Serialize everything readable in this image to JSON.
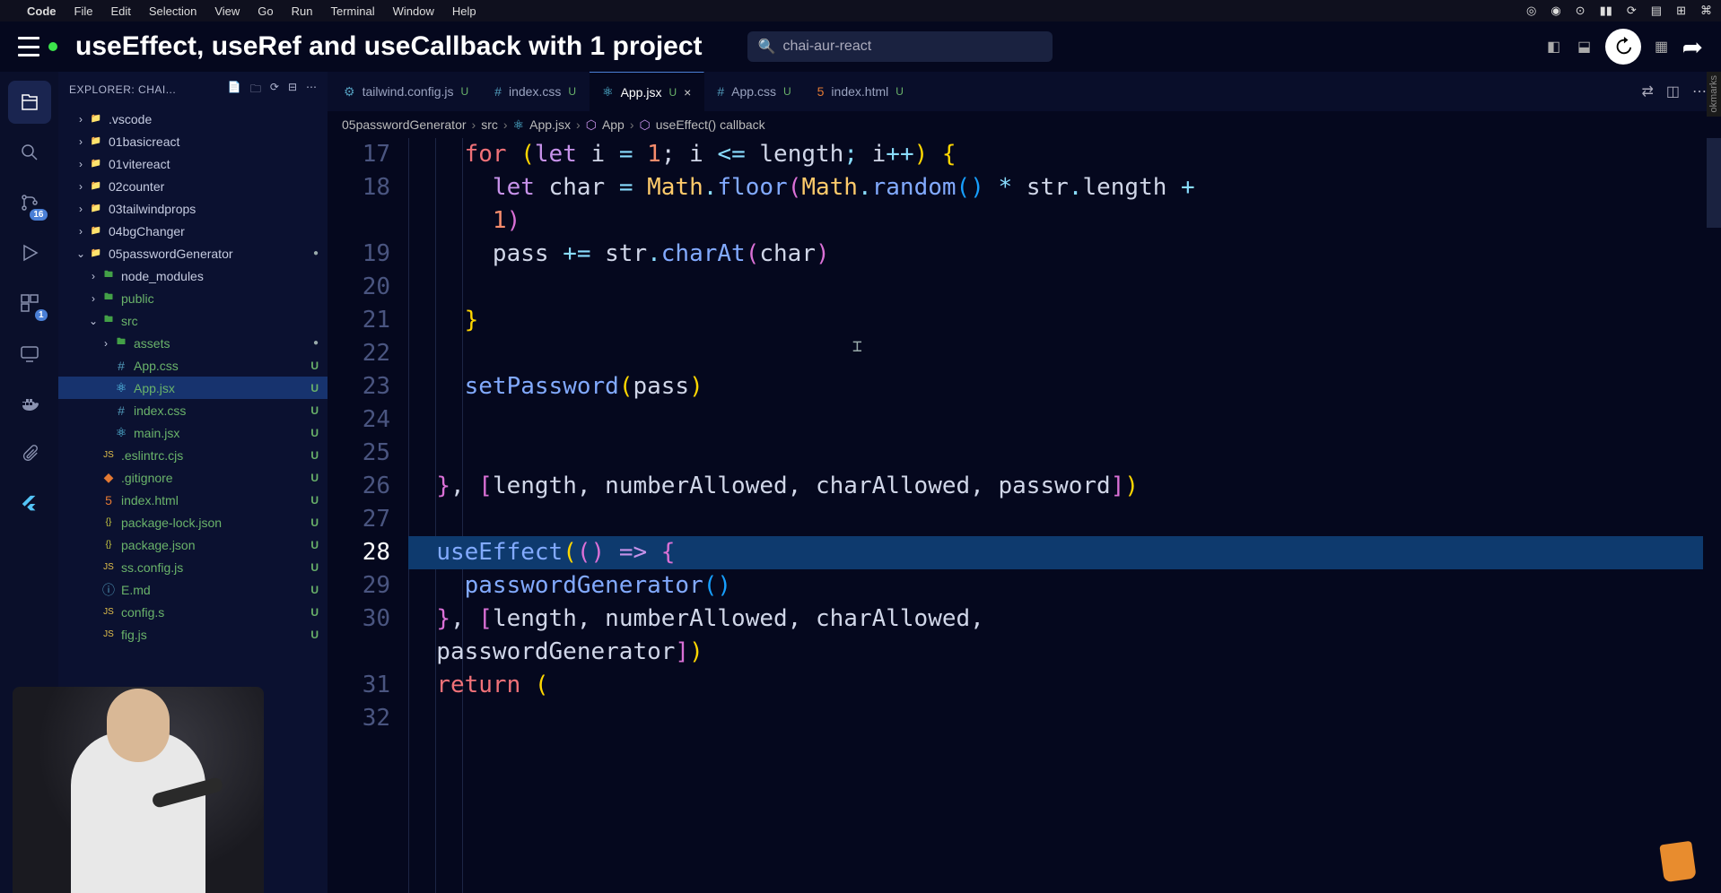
{
  "mac_menu": {
    "apple": "",
    "app": "Code",
    "items": [
      "File",
      "Edit",
      "Selection",
      "View",
      "Go",
      "Run",
      "Terminal",
      "Window",
      "Help"
    ]
  },
  "video": {
    "title": "useEffect, useRef and useCallback with 1 project",
    "search_value": "chai-aur-react"
  },
  "activity": {
    "scm_badge": "16",
    "ext_badge": "1"
  },
  "sidebar": {
    "explorer_label": "EXPLORER: CHAI..."
  },
  "tree": [
    {
      "depth": 1,
      "chev": "›",
      "icon": "📁",
      "cls": "folder-icon",
      "name": ".vscode",
      "status": "",
      "active": false,
      "untracked": false,
      "dot": false
    },
    {
      "depth": 1,
      "chev": "›",
      "icon": "📁",
      "cls": "folder-icon",
      "name": "01basicreact",
      "status": "",
      "active": false,
      "untracked": false,
      "dot": false
    },
    {
      "depth": 1,
      "chev": "›",
      "icon": "📁",
      "cls": "folder-icon",
      "name": "01vitereact",
      "status": "",
      "active": false,
      "untracked": false,
      "dot": false
    },
    {
      "depth": 1,
      "chev": "›",
      "icon": "📁",
      "cls": "folder-icon",
      "name": "02counter",
      "status": "",
      "active": false,
      "untracked": false,
      "dot": false
    },
    {
      "depth": 1,
      "chev": "›",
      "icon": "📁",
      "cls": "folder-icon",
      "name": "03tailwindprops",
      "status": "",
      "active": false,
      "untracked": false,
      "dot": false
    },
    {
      "depth": 1,
      "chev": "›",
      "icon": "📁",
      "cls": "folder-icon",
      "name": "04bgChanger",
      "status": "",
      "active": false,
      "untracked": false,
      "dot": false
    },
    {
      "depth": 1,
      "chev": "⌄",
      "icon": "📁",
      "cls": "folder-icon",
      "name": "05passwordGenerator",
      "status": "",
      "active": false,
      "untracked": false,
      "dot": true
    },
    {
      "depth": 2,
      "chev": "›",
      "icon": "🖿",
      "cls": "folder-green",
      "name": "node_modules",
      "status": "",
      "active": false,
      "untracked": false,
      "dot": false
    },
    {
      "depth": 2,
      "chev": "›",
      "icon": "🖿",
      "cls": "folder-green",
      "name": "public",
      "status": "",
      "active": false,
      "untracked": true,
      "dot": false
    },
    {
      "depth": 2,
      "chev": "⌄",
      "icon": "🖿",
      "cls": "folder-green",
      "name": "src",
      "status": "",
      "active": false,
      "untracked": true,
      "dot": false
    },
    {
      "depth": 3,
      "chev": "›",
      "icon": "🖿",
      "cls": "folder-green",
      "name": "assets",
      "status": "",
      "active": false,
      "untracked": true,
      "dot": true
    },
    {
      "depth": 3,
      "chev": "",
      "icon": "#",
      "cls": "file-blue",
      "name": "App.css",
      "status": "U",
      "active": false,
      "untracked": true,
      "dot": false
    },
    {
      "depth": 3,
      "chev": "",
      "icon": "⚛",
      "cls": "file-react",
      "name": "App.jsx",
      "status": "U",
      "active": true,
      "untracked": true,
      "dot": false
    },
    {
      "depth": 3,
      "chev": "",
      "icon": "#",
      "cls": "file-blue",
      "name": "index.css",
      "status": "U",
      "active": false,
      "untracked": true,
      "dot": false
    },
    {
      "depth": 3,
      "chev": "",
      "icon": "⚛",
      "cls": "file-react",
      "name": "main.jsx",
      "status": "U",
      "active": false,
      "untracked": true,
      "dot": false
    },
    {
      "depth": 2,
      "chev": "",
      "icon": "JS",
      "cls": "file-yellow",
      "name": ".eslintrc.cjs",
      "status": "U",
      "active": false,
      "untracked": true,
      "dot": false
    },
    {
      "depth": 2,
      "chev": "",
      "icon": "◆",
      "cls": "file-orange",
      "name": ".gitignore",
      "status": "U",
      "active": false,
      "untracked": true,
      "dot": false
    },
    {
      "depth": 2,
      "chev": "",
      "icon": "5",
      "cls": "file-orange",
      "name": "index.html",
      "status": "U",
      "active": false,
      "untracked": true,
      "dot": false
    },
    {
      "depth": 2,
      "chev": "",
      "icon": "{}",
      "cls": "file-json",
      "name": "package-lock.json",
      "status": "U",
      "active": false,
      "untracked": true,
      "dot": false
    },
    {
      "depth": 2,
      "chev": "",
      "icon": "{}",
      "cls": "file-json",
      "name": "package.json",
      "status": "U",
      "active": false,
      "untracked": true,
      "dot": false
    },
    {
      "depth": 2,
      "chev": "",
      "icon": "JS",
      "cls": "file-yellow",
      "name": "ss.config.js",
      "status": "U",
      "active": false,
      "untracked": true,
      "dot": false
    },
    {
      "depth": 2,
      "chev": "",
      "icon": "ⓘ",
      "cls": "file-blue",
      "name": "E.md",
      "status": "U",
      "active": false,
      "untracked": true,
      "dot": false
    },
    {
      "depth": 2,
      "chev": "",
      "icon": "JS",
      "cls": "file-yellow",
      "name": "config.s",
      "status": "U",
      "active": false,
      "untracked": true,
      "dot": false
    },
    {
      "depth": 2,
      "chev": "",
      "icon": "JS",
      "cls": "file-yellow",
      "name": "fig.js",
      "status": "U",
      "active": false,
      "untracked": true,
      "dot": false
    }
  ],
  "tabs": [
    {
      "icon": "⚙",
      "cls": "file-blue",
      "label": "tailwind.config.js",
      "status": "U",
      "active": false,
      "close": false
    },
    {
      "icon": "#",
      "cls": "file-blue",
      "label": "index.css",
      "status": "U",
      "active": false,
      "close": false
    },
    {
      "icon": "⚛",
      "cls": "file-react",
      "label": "App.jsx",
      "status": "U",
      "active": true,
      "close": true
    },
    {
      "icon": "#",
      "cls": "file-blue",
      "label": "App.css",
      "status": "U",
      "active": false,
      "close": false
    },
    {
      "icon": "5",
      "cls": "file-orange",
      "label": "index.html",
      "status": "U",
      "active": false,
      "close": false
    }
  ],
  "breadcrumb": {
    "parts": [
      "05passwordGenerator",
      "src",
      "App.jsx",
      "App",
      "useEffect() callback"
    ]
  },
  "code": {
    "lines": [
      {
        "num": "17",
        "active": false,
        "tokens": [
          {
            "t": "    ",
            "c": ""
          },
          {
            "t": "for",
            "c": "tk-kw"
          },
          {
            "t": " ",
            "c": ""
          },
          {
            "t": "(",
            "c": "tk-paren"
          },
          {
            "t": "let",
            "c": "tk-kw2"
          },
          {
            "t": " i ",
            "c": "tk-id"
          },
          {
            "t": "=",
            "c": "tk-op"
          },
          {
            "t": " ",
            "c": ""
          },
          {
            "t": "1",
            "c": "tk-num"
          },
          {
            "t": "; i ",
            "c": "tk-id"
          },
          {
            "t": "<=",
            "c": "tk-op"
          },
          {
            "t": " length",
            "c": "tk-id"
          },
          {
            "t": ";",
            "c": "tk-op"
          },
          {
            "t": " i",
            "c": "tk-id"
          },
          {
            "t": "++",
            "c": "tk-op"
          },
          {
            "t": ")",
            "c": "tk-paren"
          },
          {
            "t": " ",
            "c": ""
          },
          {
            "t": "{",
            "c": "tk-paren"
          }
        ]
      },
      {
        "num": "18",
        "active": false,
        "tokens": [
          {
            "t": "      ",
            "c": ""
          },
          {
            "t": "let",
            "c": "tk-kw2"
          },
          {
            "t": " char ",
            "c": "tk-id"
          },
          {
            "t": "=",
            "c": "tk-op"
          },
          {
            "t": " ",
            "c": ""
          },
          {
            "t": "Math",
            "c": "tk-ns"
          },
          {
            "t": ".",
            "c": "tk-op"
          },
          {
            "t": "floor",
            "c": "tk-fn"
          },
          {
            "t": "(",
            "c": "tk-paren2"
          },
          {
            "t": "Math",
            "c": "tk-ns"
          },
          {
            "t": ".",
            "c": "tk-op"
          },
          {
            "t": "random",
            "c": "tk-fn"
          },
          {
            "t": "()",
            "c": "tk-paren3"
          },
          {
            "t": " ",
            "c": ""
          },
          {
            "t": "*",
            "c": "tk-op"
          },
          {
            "t": " str",
            "c": "tk-id"
          },
          {
            "t": ".",
            "c": "tk-op"
          },
          {
            "t": "length",
            "c": "tk-id"
          },
          {
            "t": " ",
            "c": ""
          },
          {
            "t": "+",
            "c": "tk-op"
          },
          {
            "t": " ",
            "c": ""
          }
        ]
      },
      {
        "num": "",
        "active": false,
        "tokens": [
          {
            "t": "      ",
            "c": ""
          },
          {
            "t": "1",
            "c": "tk-num"
          },
          {
            "t": ")",
            "c": "tk-paren2"
          }
        ]
      },
      {
        "num": "19",
        "active": false,
        "tokens": [
          {
            "t": "      pass ",
            "c": "tk-id"
          },
          {
            "t": "+=",
            "c": "tk-op"
          },
          {
            "t": " str",
            "c": "tk-id"
          },
          {
            "t": ".",
            "c": "tk-op"
          },
          {
            "t": "charAt",
            "c": "tk-fn"
          },
          {
            "t": "(",
            "c": "tk-paren2"
          },
          {
            "t": "char",
            "c": "tk-id"
          },
          {
            "t": ")",
            "c": "tk-paren2"
          }
        ]
      },
      {
        "num": "20",
        "active": false,
        "tokens": [
          {
            "t": "      ",
            "c": ""
          }
        ]
      },
      {
        "num": "21",
        "active": false,
        "tokens": [
          {
            "t": "    ",
            "c": ""
          },
          {
            "t": "}",
            "c": "tk-paren"
          }
        ]
      },
      {
        "num": "22",
        "active": false,
        "tokens": [
          {
            "t": "",
            "c": ""
          }
        ]
      },
      {
        "num": "23",
        "active": false,
        "tokens": [
          {
            "t": "    ",
            "c": ""
          },
          {
            "t": "setPassword",
            "c": "tk-fn"
          },
          {
            "t": "(",
            "c": "tk-paren"
          },
          {
            "t": "pass",
            "c": "tk-id"
          },
          {
            "t": ")",
            "c": "tk-paren"
          }
        ]
      },
      {
        "num": "24",
        "active": false,
        "tokens": [
          {
            "t": "",
            "c": ""
          }
        ]
      },
      {
        "num": "25",
        "active": false,
        "tokens": [
          {
            "t": "",
            "c": ""
          }
        ]
      },
      {
        "num": "26",
        "active": false,
        "tokens": [
          {
            "t": "  ",
            "c": ""
          },
          {
            "t": "}",
            "c": "tk-paren2"
          },
          {
            "t": ", ",
            "c": "tk-id"
          },
          {
            "t": "[",
            "c": "tk-paren2"
          },
          {
            "t": "length",
            "c": "tk-id"
          },
          {
            "t": ", ",
            "c": "tk-id"
          },
          {
            "t": "numberAllowed",
            "c": "tk-id"
          },
          {
            "t": ", ",
            "c": "tk-id"
          },
          {
            "t": "charAllowed",
            "c": "tk-id"
          },
          {
            "t": ", ",
            "c": "tk-id"
          },
          {
            "t": "password",
            "c": "tk-id"
          },
          {
            "t": "]",
            "c": "tk-paren2"
          },
          {
            "t": ")",
            "c": "tk-paren"
          }
        ]
      },
      {
        "num": "27",
        "active": false,
        "tokens": [
          {
            "t": "",
            "c": ""
          }
        ]
      },
      {
        "num": "28",
        "active": true,
        "tokens": [
          {
            "t": "  ",
            "c": ""
          },
          {
            "t": "useEffect",
            "c": "tk-fn"
          },
          {
            "t": "(",
            "c": "tk-paren"
          },
          {
            "t": "()",
            "c": "tk-paren2"
          },
          {
            "t": " ",
            "c": ""
          },
          {
            "t": "=>",
            "c": "tk-kw2"
          },
          {
            "t": " ",
            "c": ""
          },
          {
            "t": "{",
            "c": "tk-paren2"
          }
        ]
      },
      {
        "num": "29",
        "active": false,
        "tokens": [
          {
            "t": "    ",
            "c": ""
          },
          {
            "t": "passwordGenerator",
            "c": "tk-fn"
          },
          {
            "t": "()",
            "c": "tk-paren3"
          }
        ]
      },
      {
        "num": "30",
        "active": false,
        "tokens": [
          {
            "t": "  ",
            "c": ""
          },
          {
            "t": "}",
            "c": "tk-paren2"
          },
          {
            "t": ", ",
            "c": "tk-id"
          },
          {
            "t": "[",
            "c": "tk-paren2"
          },
          {
            "t": "length",
            "c": "tk-id"
          },
          {
            "t": ", ",
            "c": "tk-id"
          },
          {
            "t": "numberAllowed",
            "c": "tk-id"
          },
          {
            "t": ", ",
            "c": "tk-id"
          },
          {
            "t": "charAllowed",
            "c": "tk-id"
          },
          {
            "t": ", ",
            "c": "tk-id"
          }
        ]
      },
      {
        "num": "",
        "active": false,
        "tokens": [
          {
            "t": "  passwordGenerator",
            "c": "tk-id"
          },
          {
            "t": "]",
            "c": "tk-paren2"
          },
          {
            "t": ")",
            "c": "tk-paren"
          }
        ]
      },
      {
        "num": "31",
        "active": false,
        "tokens": [
          {
            "t": "  ",
            "c": ""
          },
          {
            "t": "return",
            "c": "tk-kw"
          },
          {
            "t": " ",
            "c": ""
          },
          {
            "t": "(",
            "c": "tk-paren"
          }
        ]
      },
      {
        "num": "32",
        "active": false,
        "tokens": [
          {
            "t": "",
            "c": ""
          }
        ]
      }
    ]
  },
  "bookmarks_label": "okmarks"
}
